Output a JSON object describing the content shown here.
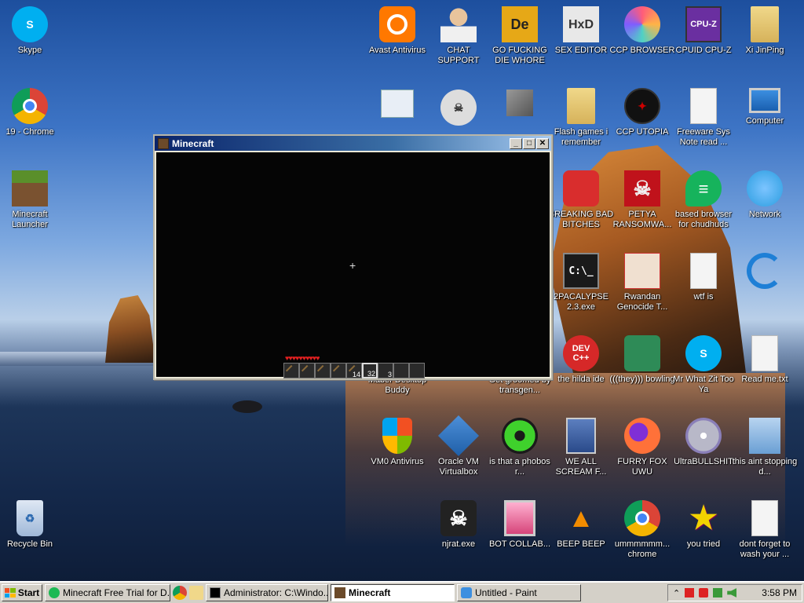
{
  "desktop_icons": [
    {
      "id": "skype",
      "label": "Skype",
      "color": "#00aff0",
      "glyph": "S"
    },
    {
      "id": "chrome19",
      "label": "19 - Chrome",
      "color": "#db4437",
      "glyph": ""
    },
    {
      "id": "mclauncher",
      "label": "Minecraft Launcher",
      "color": "#5a8f2b",
      "glyph": ""
    },
    {
      "id": "recycle",
      "label": "Recycle Bin",
      "color": "#9fb8d8",
      "glyph": ""
    },
    {
      "id": "avast",
      "label": "Avast Antivirus",
      "color": "#ff7800",
      "glyph": ""
    },
    {
      "id": "chatsupport",
      "label": "CHAT SUPPORT",
      "color": "#d9b38c",
      "glyph": ""
    },
    {
      "id": "gofd",
      "label": "GO FUCKING DIE WHORE",
      "color": "#e6a817",
      "glyph": "De"
    },
    {
      "id": "sexeditor",
      "label": "SEX EDITOR",
      "color": "#e8e8e8",
      "glyph": "HxD"
    },
    {
      "id": "ccpbrowser",
      "label": "CCP BROWSER",
      "color": "#ff5c7a",
      "glyph": ""
    },
    {
      "id": "cpuz",
      "label": "CPUID CPU-Z",
      "color": "#6a2fa0",
      "glyph": "CPU-Z"
    },
    {
      "id": "xijinping",
      "label": "Xi JinPing",
      "color": "#e6c26b",
      "glyph": ""
    },
    {
      "id": "flashgames",
      "label": "Flash games i remember",
      "color": "#e6c26b",
      "glyph": ""
    },
    {
      "id": "ccputopia",
      "label": "CCP UTOPIA",
      "color": "#111111",
      "glyph": ""
    },
    {
      "id": "freeware",
      "label": "Freeware Sys Note read ...",
      "color": "#f4f4f4",
      "glyph": ""
    },
    {
      "id": "computer",
      "label": "Computer",
      "color": "#3c8fe0",
      "glyph": ""
    },
    {
      "id": "breakingbad",
      "label": "BREAKING BAD BITCHES",
      "color": "#d92d2d",
      "glyph": ""
    },
    {
      "id": "petya",
      "label": "PETYA RANSOMWA...",
      "color": "#c0121b",
      "glyph": "☠"
    },
    {
      "id": "basedbrowser",
      "label": "based browser for chudhuds",
      "color": "#16b35c",
      "glyph": "≡"
    },
    {
      "id": "network",
      "label": "Network",
      "color": "#2a9de0",
      "glyph": ""
    },
    {
      "id": "apocalypse",
      "label": "2PACALYPSE 2.3.exe",
      "color": "#1a1a1a",
      "glyph": "C:\\_"
    },
    {
      "id": "rwandan",
      "label": "Rwandan Genocide T...",
      "color": "#f0e0d0",
      "glyph": ""
    },
    {
      "id": "wtfis",
      "label": "wtf is",
      "color": "#f4f4f4",
      "glyph": ""
    },
    {
      "id": "bluecircle",
      "label": "",
      "color": "#1e7fd6",
      "glyph": ""
    },
    {
      "id": "devcpp",
      "label": "the hilda ide",
      "color": "#d62828",
      "glyph": "DEV C++"
    },
    {
      "id": "theybowling",
      "label": "(((they))) bowling",
      "color": "#2e8b57",
      "glyph": ""
    },
    {
      "id": "mrwhatzit",
      "label": "Mr What Zit Too Ya",
      "color": "#00aff0",
      "glyph": "S"
    },
    {
      "id": "readme",
      "label": "Read me.txt",
      "color": "#f4f4f4",
      "glyph": ""
    },
    {
      "id": "maber",
      "label": "Maber Desktop Buddy",
      "color": "#7a3fa0",
      "glyph": ""
    },
    {
      "id": "groomed",
      "label": "Get groomed by transgen...",
      "color": "#c84f8a",
      "glyph": ""
    },
    {
      "id": "vmo",
      "label": "VM0 Antivirus",
      "color": "#3a7bd5",
      "glyph": ""
    },
    {
      "id": "virtualbox",
      "label": "Oracle VM Virtualbox",
      "color": "#1f5fa8",
      "glyph": ""
    },
    {
      "id": "phobos",
      "label": "is that a phobos r...",
      "color": "#1a1a1a",
      "glyph": ""
    },
    {
      "id": "wescream",
      "label": "WE ALL SCREAM F...",
      "color": "#5c7fbf",
      "glyph": ""
    },
    {
      "id": "furryfox",
      "label": "FURRY FOX UWU",
      "color": "#ff7139",
      "glyph": ""
    },
    {
      "id": "ultrabs",
      "label": "UltraBULLSHIT",
      "color": "#b8b8c8",
      "glyph": ""
    },
    {
      "id": "thisaint",
      "label": "this aint stopping d...",
      "color": "#6a9fd4",
      "glyph": ""
    },
    {
      "id": "njrat",
      "label": "njrat.exe",
      "color": "#222222",
      "glyph": "☠"
    },
    {
      "id": "botcollab",
      "label": "BOT COLLAB...",
      "color": "#d6457a",
      "glyph": ""
    },
    {
      "id": "beepbeep",
      "label": "BEEP BEEP",
      "color": "#f28c00",
      "glyph": "▲"
    },
    {
      "id": "ummchrome",
      "label": "ummmmmm... chrome",
      "color": "#db4437",
      "glyph": ""
    },
    {
      "id": "youtried",
      "label": "you tried",
      "color": "#f2d300",
      "glyph": "★"
    },
    {
      "id": "dontforget",
      "label": "dont forget to wash your ...",
      "color": "#f4f4f4",
      "glyph": ""
    }
  ],
  "minecraft_window": {
    "title": "Minecraft",
    "crosshair": "+",
    "hearts": "♥♥♥♥♥♥♥♥♥♥",
    "hotbar_counts": [
      "",
      "",
      "",
      "",
      "14",
      "32",
      "3",
      "",
      ""
    ],
    "selected_slot": 5
  },
  "taskbar": {
    "start_label": "Start",
    "tasks": [
      {
        "label": "Minecraft Free Trial for D...",
        "active": false,
        "color": "#1db954"
      },
      {
        "label": "Administrator: C:\\Windo...",
        "active": false,
        "color": "#000000"
      },
      {
        "label": "Minecraft",
        "active": true,
        "color": "#6b4a2a"
      },
      {
        "label": "Untitled - Paint",
        "active": false,
        "color": "#3c8fe0"
      }
    ],
    "clock": "3:58 PM"
  }
}
